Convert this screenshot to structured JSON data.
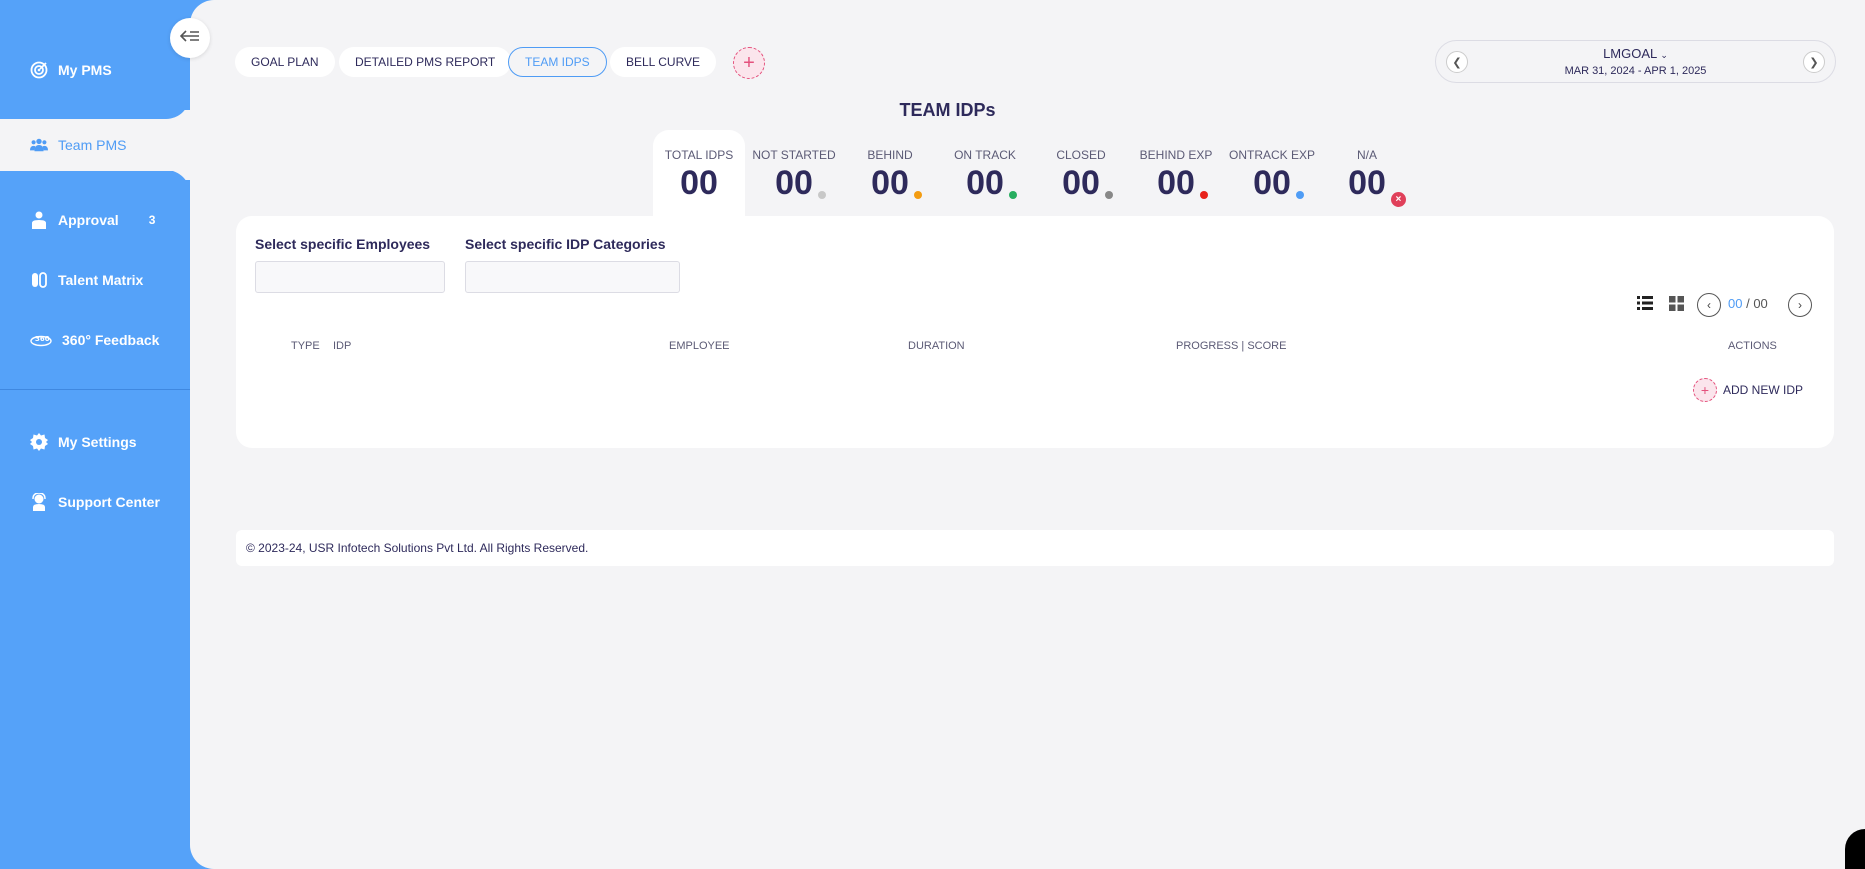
{
  "sidebar": {
    "items": [
      {
        "label": "My PMS",
        "icon": "target-icon"
      },
      {
        "label": "Team PMS",
        "icon": "team-icon"
      },
      {
        "label": "Approval",
        "icon": "approval-icon",
        "badge": "3"
      },
      {
        "label": "Talent Matrix",
        "icon": "matrix-icon"
      },
      {
        "label": "360° Feedback",
        "icon": "feedback-360-icon"
      },
      {
        "label": "My Settings",
        "icon": "gear-icon"
      },
      {
        "label": "Support Center",
        "icon": "support-icon"
      }
    ]
  },
  "tabs": [
    "GOAL PLAN",
    "DETAILED PMS REPORT",
    "TEAM IDPS",
    "BELL CURVE"
  ],
  "period": {
    "title": "LMGOAL",
    "dates": "MAR 31, 2024 - APR 1, 2025"
  },
  "page_title": "TEAM IDPs",
  "stats": [
    {
      "label": "TOTAL IDPS",
      "value": "00",
      "color": ""
    },
    {
      "label": "NOT STARTED",
      "value": "00",
      "color": "#c8c8c8"
    },
    {
      "label": "BEHIND",
      "value": "00",
      "color": "#f39c12"
    },
    {
      "label": "ON TRACK",
      "value": "00",
      "color": "#27ae60"
    },
    {
      "label": "CLOSED",
      "value": "00",
      "color": "#888888"
    },
    {
      "label": "BEHIND EXP",
      "value": "00",
      "color": "#e8221b"
    },
    {
      "label": "ONTRACK EXP",
      "value": "00",
      "color": "#4f9cf5"
    },
    {
      "label": "N/A",
      "value": "00",
      "color": "#e0405a"
    }
  ],
  "filters": {
    "employees_label": "Select specific Employees",
    "categories_label": "Select specific IDP Categories"
  },
  "pager": {
    "current": "00",
    "separator": " / ",
    "total": "00"
  },
  "table": {
    "headers": [
      "TYPE",
      "IDP",
      "EMPLOYEE",
      "DURATION",
      "PROGRESS | SCORE",
      "ACTIONS"
    ]
  },
  "add_idp_label": "ADD NEW IDP",
  "footer": "© 2023-24, USR Infotech Solutions Pvt Ltd. All Rights Reserved.",
  "colors": {
    "accent": "#55a2f9",
    "pink": "#e4517d",
    "dark_text": "#2e2a5b"
  }
}
